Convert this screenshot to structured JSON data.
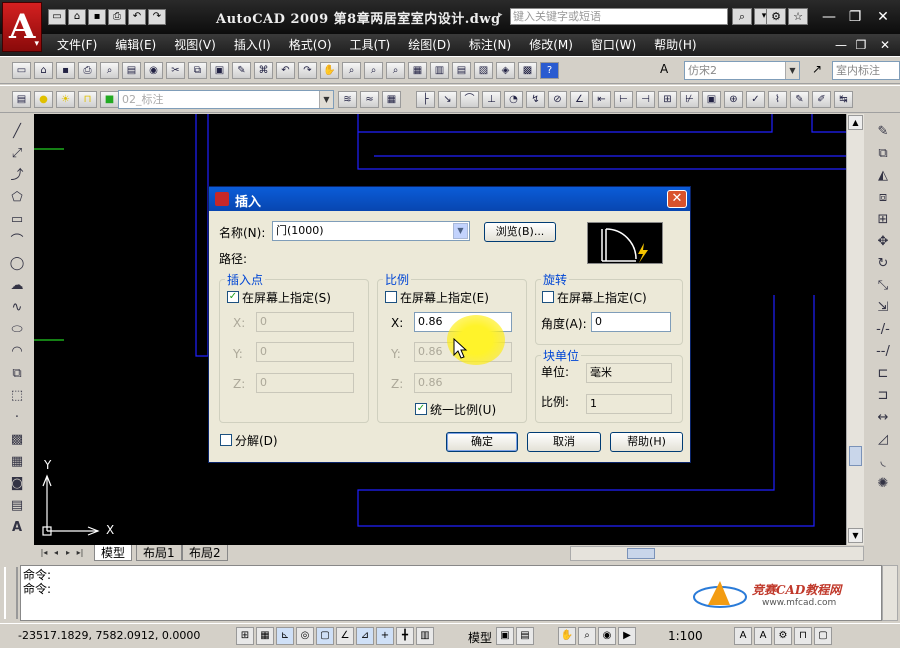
{
  "app": {
    "logo": "A",
    "title": "AutoCAD 2009  第8章两居室室内设计.dwg",
    "search_placeholder": "键入关键字或短语"
  },
  "menu": [
    "文件(F)",
    "编辑(E)",
    "视图(V)",
    "插入(I)",
    "格式(O)",
    "工具(T)",
    "绘图(D)",
    "标注(N)",
    "修改(M)",
    "窗口(W)",
    "帮助(H)"
  ],
  "toolbar": {
    "font_combo": "仿宋2",
    "dimstyle_combo": "室内标注",
    "layer_combo": "02_标注"
  },
  "canvas": {
    "ucs_x": "X",
    "ucs_y": "Y",
    "colors": {
      "background": "#000000",
      "lines": "#2020ff",
      "green": "#22cc22"
    }
  },
  "layout_tabs": [
    "模型",
    "布局1",
    "布局2"
  ],
  "command": {
    "lines": [
      "命令:",
      "命令:"
    ]
  },
  "watermark": {
    "title": "竞赛CAD教程网",
    "url": "www.mfcad.com"
  },
  "status": {
    "coords": "-23517.1829, 7582.0912, 0.0000",
    "model": "模型",
    "scale": "1:100"
  },
  "dialog": {
    "title": "插入",
    "name_label": "名称(N):",
    "name_value": "门(1000)",
    "browse": "浏览(B)...",
    "path_label": "路径:",
    "insertion": {
      "title": "插入点",
      "specify": "在屏幕上指定(S)",
      "specify_checked": true,
      "x_label": "X:",
      "x": "0",
      "y_label": "Y:",
      "y": "0",
      "z_label": "Z:",
      "z": "0"
    },
    "scale": {
      "title": "比例",
      "specify": "在屏幕上指定(E)",
      "specify_checked": false,
      "x_label": "X:",
      "x": "0.86",
      "y_label": "Y:",
      "y": "0.86",
      "z_label": "Z:",
      "z": "0.86",
      "uniform": "统一比例(U)",
      "uniform_checked": true
    },
    "rotation": {
      "title": "旋转",
      "specify": "在屏幕上指定(C)",
      "specify_checked": false,
      "angle_label": "角度(A):",
      "angle": "0"
    },
    "units": {
      "title": "块单位",
      "unit_label": "单位:",
      "unit": "毫米",
      "factor_label": "比例:",
      "factor": "1"
    },
    "explode": "分解(D)",
    "explode_checked": false,
    "ok": "确定",
    "cancel": "取消",
    "help": "帮助(H)"
  }
}
